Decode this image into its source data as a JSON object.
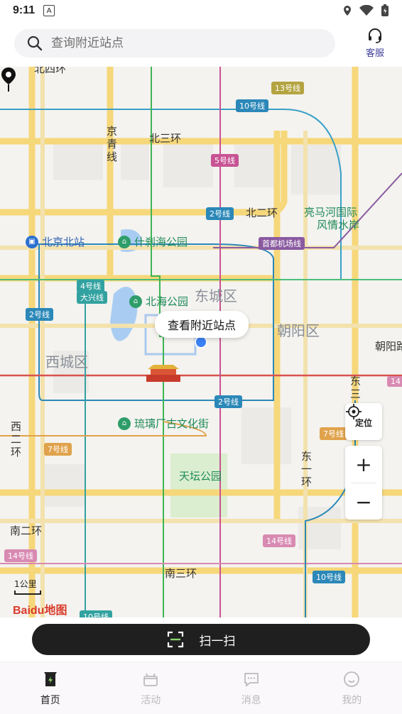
{
  "status_bar": {
    "time": "9:11",
    "notification_glyph": "A"
  },
  "header": {
    "search_placeholder": "查询附近站点",
    "service_label": "客服"
  },
  "map": {
    "districts": [
      "东城区",
      "西城区",
      "朝阳区"
    ],
    "roads": [
      "北三环",
      "北二环",
      "南二环",
      "南三环",
      "京",
      "青",
      "线",
      "西",
      "二",
      "环",
      "东",
      "一",
      "环",
      "东",
      "三",
      "北四环",
      "朝阳路"
    ],
    "lines": [
      "13号线",
      "10号线",
      "5号线",
      "2号线",
      "首都机场线",
      "4号线",
      "大兴线",
      "2号线",
      "2号线",
      "7号线",
      "7号线",
      "14号线",
      "14号线",
      "10号线",
      "14",
      "10号线"
    ],
    "pois": [
      "什刹海公园",
      "北海公园",
      "琉璃厂古文化街",
      "天坛公园",
      "亮马河国际",
      "风情水岸",
      "北京北站"
    ],
    "tooltip": "查看附近站点",
    "locate_label": "定位",
    "zoom_in": "+",
    "zoom_out": "−",
    "scale": "1公里",
    "baidu_logo": "Baidu地图"
  },
  "scan_button": {
    "label": "扫一扫"
  },
  "bottom_nav": {
    "items": [
      {
        "label": "首页",
        "icon": "home-station-icon",
        "active": true
      },
      {
        "label": "活动",
        "icon": "gift-icon",
        "active": false
      },
      {
        "label": "消息",
        "icon": "message-icon",
        "active": false
      },
      {
        "label": "我的",
        "icon": "profile-icon",
        "active": false
      }
    ]
  },
  "colors": {
    "accent": "#1f1f1f",
    "scan_green": "#8bd36b",
    "poi_green": "#2e9d6a",
    "map_bg": "#f4f3ef"
  }
}
